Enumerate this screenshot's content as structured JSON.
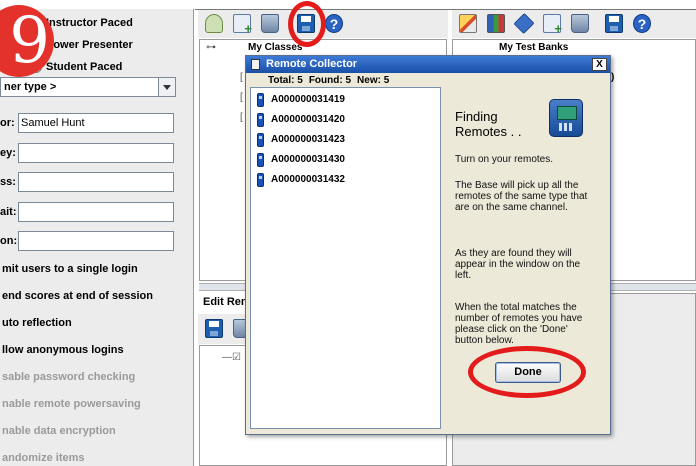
{
  "step_number": "9",
  "left_panel": {
    "radio_options": [
      "Instructor Paced",
      "Power Presenter",
      "Student Paced"
    ],
    "combo_value": "ner type >",
    "fields": [
      {
        "label": "or:",
        "value": "Samuel Hunt"
      },
      {
        "label": "ey:",
        "value": ""
      },
      {
        "label": "ss:",
        "value": ""
      },
      {
        "label": "ait:",
        "value": ""
      },
      {
        "label": "on:",
        "value": ""
      }
    ],
    "checks": [
      {
        "label": "mit users to a single login",
        "enabled": true
      },
      {
        "label": "end scores at end of session",
        "enabled": true
      },
      {
        "label": "uto reflection",
        "enabled": true
      },
      {
        "label": "llow anonymous logins",
        "enabled": true
      },
      {
        "label": "sable password checking",
        "enabled": false
      },
      {
        "label": "nable remote powersaving",
        "enabled": false
      },
      {
        "label": "nable data encryption",
        "enabled": false
      },
      {
        "label": "andomize items",
        "enabled": false
      }
    ]
  },
  "classes_panel": {
    "tree_root": "My Classes",
    "edit_section_label": "Edit Rem"
  },
  "testbanks_panel": {
    "tree_root": "My Test Banks",
    "tree_suffix": ")"
  },
  "dialog": {
    "title": "Remote Collector",
    "close_label": "X",
    "total_label": "Total: 5",
    "found_label": "Found: 5",
    "new_label": "New: 5",
    "remotes": [
      "A000000031419",
      "A000000031420",
      "A000000031423",
      "A000000031430",
      "A000000031432"
    ],
    "heading_line1": "Finding",
    "heading_line2": "Remotes . .",
    "info": [
      "Turn on your remotes.",
      "The Base will pick up all the remotes of the same type that are on the same channel.",
      "As they are found they will appear in the window on the left.",
      "When the total matches the number of remotes you have please click on the 'Done' button below."
    ],
    "done_label": "Done"
  },
  "icons": {
    "toolbar_left": [
      "add-class-icon",
      "add-roster-icon",
      "delete-icon",
      "save-icon",
      "help-icon"
    ],
    "toolbar_right": [
      "edit-icon",
      "test-bank-icon",
      "question-icon",
      "add-test-icon",
      "delete-icon",
      "save-icon",
      "help-icon"
    ]
  },
  "colors": {
    "annotation_red": "#e31b1b",
    "dialog_title_blue": "#1a4fa8",
    "remote_blue": "#1a52b8"
  }
}
